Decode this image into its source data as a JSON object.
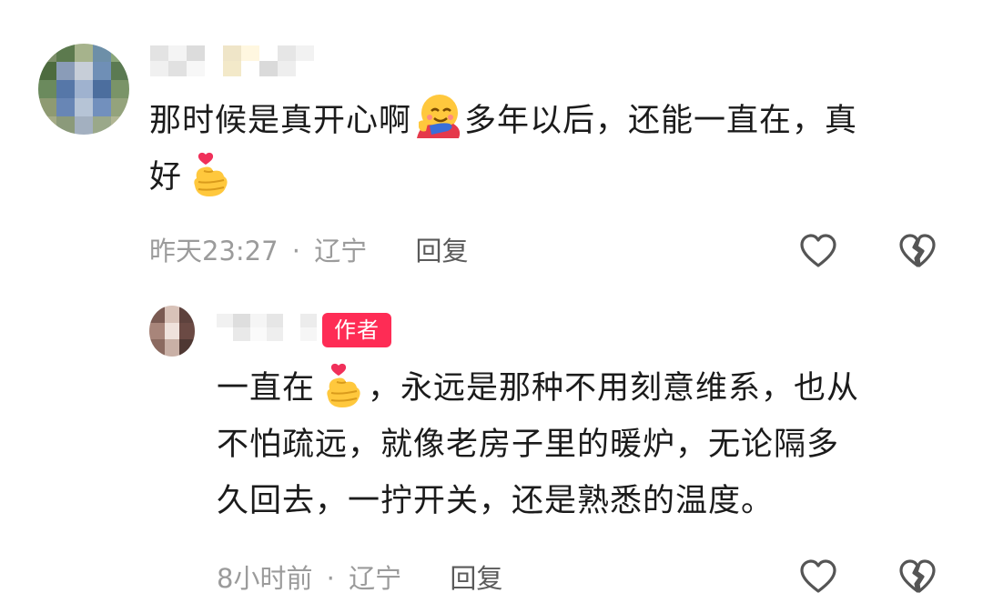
{
  "comment": {
    "text_line1_a": "那时候是真开心啊",
    "emoji_1": "hugging-face-emoji",
    "text_line1_b": "多年以后，还能一直在，真",
    "text_line2": "好",
    "emoji_2": "finger-heart-emoji",
    "time": "昨天23:27",
    "separator": "·",
    "location": "辽宁",
    "reply_label": "回复"
  },
  "reply": {
    "author_badge": "作者",
    "text_line1_a": "一直在",
    "emoji": "finger-heart-emoji",
    "text_line1_b": "，永远是那种不用刻意维系，也从",
    "text_line2": "不怕疏远，就像老房子里的暖炉，无论隔多",
    "text_line3": "久回去，一拧开关，还是熟悉的温度。",
    "time": "8小时前",
    "separator": "·",
    "location": "辽宁",
    "reply_label": "回复"
  },
  "icons": {
    "like": "heart-outline-icon",
    "dislike": "broken-heart-icon"
  },
  "colors": {
    "badge": "#fe2c55",
    "meta_text": "#9b9b9b",
    "reply_text": "#5a5a5a",
    "icon_stroke": "#555555"
  }
}
